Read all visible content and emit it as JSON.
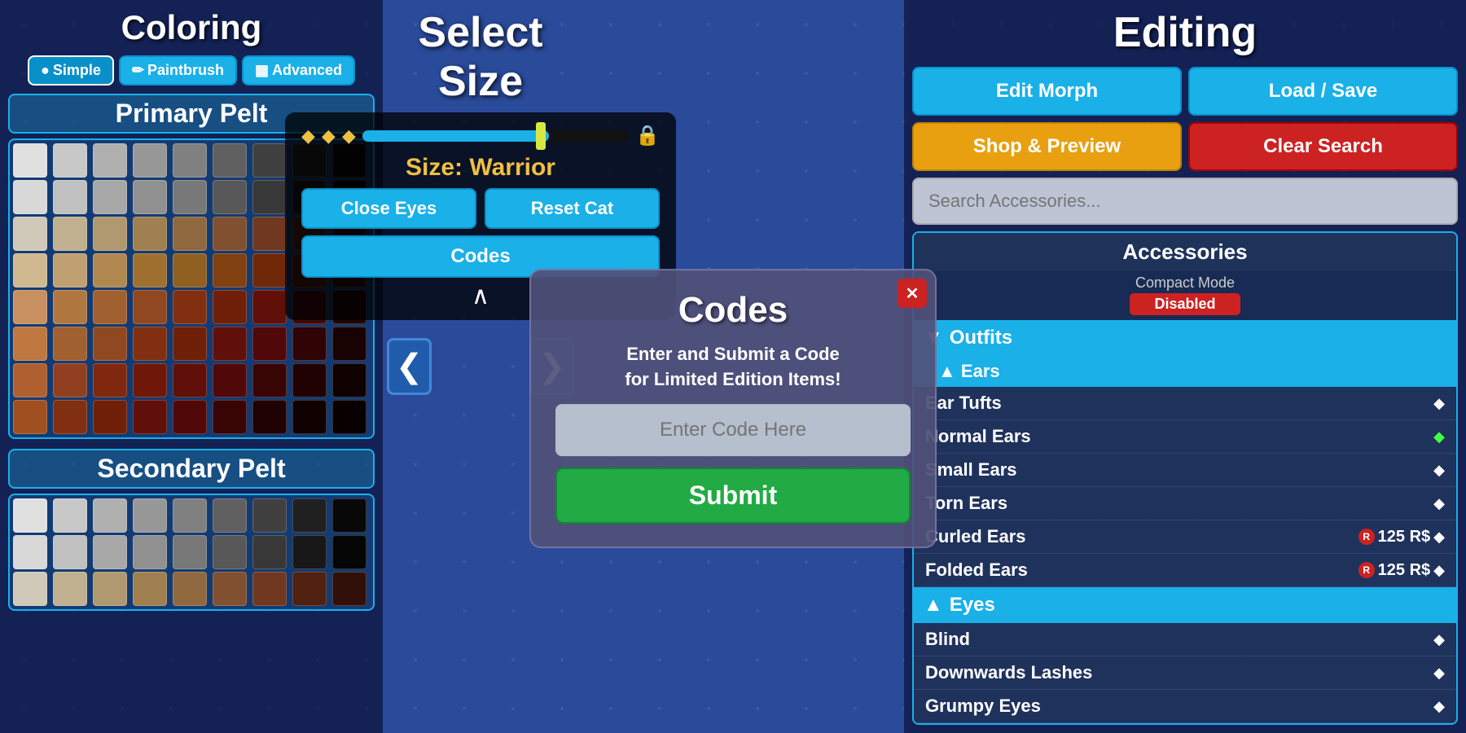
{
  "left_panel": {
    "title": "Coloring",
    "modes": [
      {
        "label": "Simple",
        "icon": "●",
        "active": true
      },
      {
        "label": "Paintbrush",
        "icon": "✏",
        "active": false
      },
      {
        "label": "Advanced",
        "icon": "▦",
        "active": false
      }
    ],
    "primary_pelt_label": "Primary Pelt",
    "secondary_pelt_label": "Secondary Pelt",
    "primary_colors": [
      "#e0e0e0",
      "#c8c8c8",
      "#b0b0b0",
      "#989898",
      "#808080",
      "#606060",
      "#404040",
      "#202020",
      "#080808",
      "#d8d8d8",
      "#c0c0c0",
      "#a8a8a8",
      "#909090",
      "#787878",
      "#585858",
      "#383838",
      "#181818",
      "#050505",
      "#d0c8b8",
      "#c0b090",
      "#b09870",
      "#a08050",
      "#906840",
      "#805030",
      "#703820",
      "#502010",
      "#301008",
      "#d0b890",
      "#c0a070",
      "#b08850",
      "#a07030",
      "#906020",
      "#804010",
      "#702808",
      "#501808",
      "#300808",
      "#c89060",
      "#b07840",
      "#a06030",
      "#904820",
      "#803010",
      "#702008",
      "#601008",
      "#400808",
      "#200404",
      "#c07840",
      "#a06030",
      "#904820",
      "#803010",
      "#702008",
      "#601008",
      "#500808",
      "#300404",
      "#180202",
      "#b06030",
      "#904020",
      "#802810",
      "#701808",
      "#601008",
      "#500808",
      "#380404",
      "#200202",
      "#100101",
      "#a05020",
      "#803010",
      "#702008",
      "#601008",
      "#500808",
      "#380404",
      "#200202",
      "#100101",
      "#080000"
    ],
    "secondary_colors": [
      "#e0e0e0",
      "#c8c8c8",
      "#b0b0b0",
      "#989898",
      "#808080",
      "#606060",
      "#404040",
      "#202020",
      "#080808",
      "#d8d8d8",
      "#c0c0c0",
      "#a8a8a8",
      "#909090",
      "#787878",
      "#585858",
      "#383838",
      "#181818",
      "#050505",
      "#d0c8b8",
      "#c0b090",
      "#b09870",
      "#a08050",
      "#906840",
      "#805030",
      "#703820",
      "#502010",
      "#301008"
    ]
  },
  "center_panel": {
    "select_size_title": "Select Size",
    "size_label": "Size: Warrior",
    "close_eyes_btn": "Close Eyes",
    "reset_cat_btn": "Reset Cat",
    "codes_btn": "Codes",
    "chevron": "∧",
    "nav_left": "❮",
    "nav_right": "❯"
  },
  "codes_modal": {
    "title": "Codes",
    "description": "Enter and Submit a Code\nfor Limited Edition Items!",
    "input_placeholder": "Enter Code Here",
    "submit_btn": "Submit",
    "close_btn": "✕"
  },
  "right_panel": {
    "title": "Editing",
    "edit_morph_btn": "Edit Morph",
    "load_save_btn": "Load / Save",
    "shop_preview_btn": "Shop & Preview",
    "clear_search_btn": "Clear Search",
    "search_placeholder": "Search Accessories...",
    "accessories_label": "Accessories",
    "compact_mode_label": "Compact Mode",
    "compact_disabled_label": "Disabled",
    "categories": [
      {
        "name": "Outfits",
        "expanded": true,
        "subcategories": [
          {
            "name": "Ears",
            "expanded": true,
            "items": [
              {
                "name": "Ear Tufts",
                "price": null,
                "currency": null,
                "selected": false
              },
              {
                "name": "Normal Ears",
                "price": null,
                "currency": null,
                "selected": true
              },
              {
                "name": "Small Ears",
                "price": null,
                "currency": null,
                "selected": false
              },
              {
                "name": "Torn Ears",
                "price": null,
                "currency": null,
                "selected": false
              },
              {
                "name": "Curled Ears",
                "price": "125 R$",
                "currency": "robux",
                "selected": false
              },
              {
                "name": "Folded Ears",
                "price": "125 R$",
                "currency": "robux",
                "selected": false
              }
            ]
          }
        ]
      },
      {
        "name": "Eyes",
        "expanded": true,
        "subcategories": [],
        "items": [
          {
            "name": "Blind",
            "price": null,
            "currency": null,
            "selected": false
          },
          {
            "name": "Downwards Lashes",
            "price": null,
            "currency": null,
            "selected": false
          },
          {
            "name": "Grumpy Eyes",
            "price": null,
            "currency": null,
            "selected": false
          }
        ]
      }
    ]
  }
}
